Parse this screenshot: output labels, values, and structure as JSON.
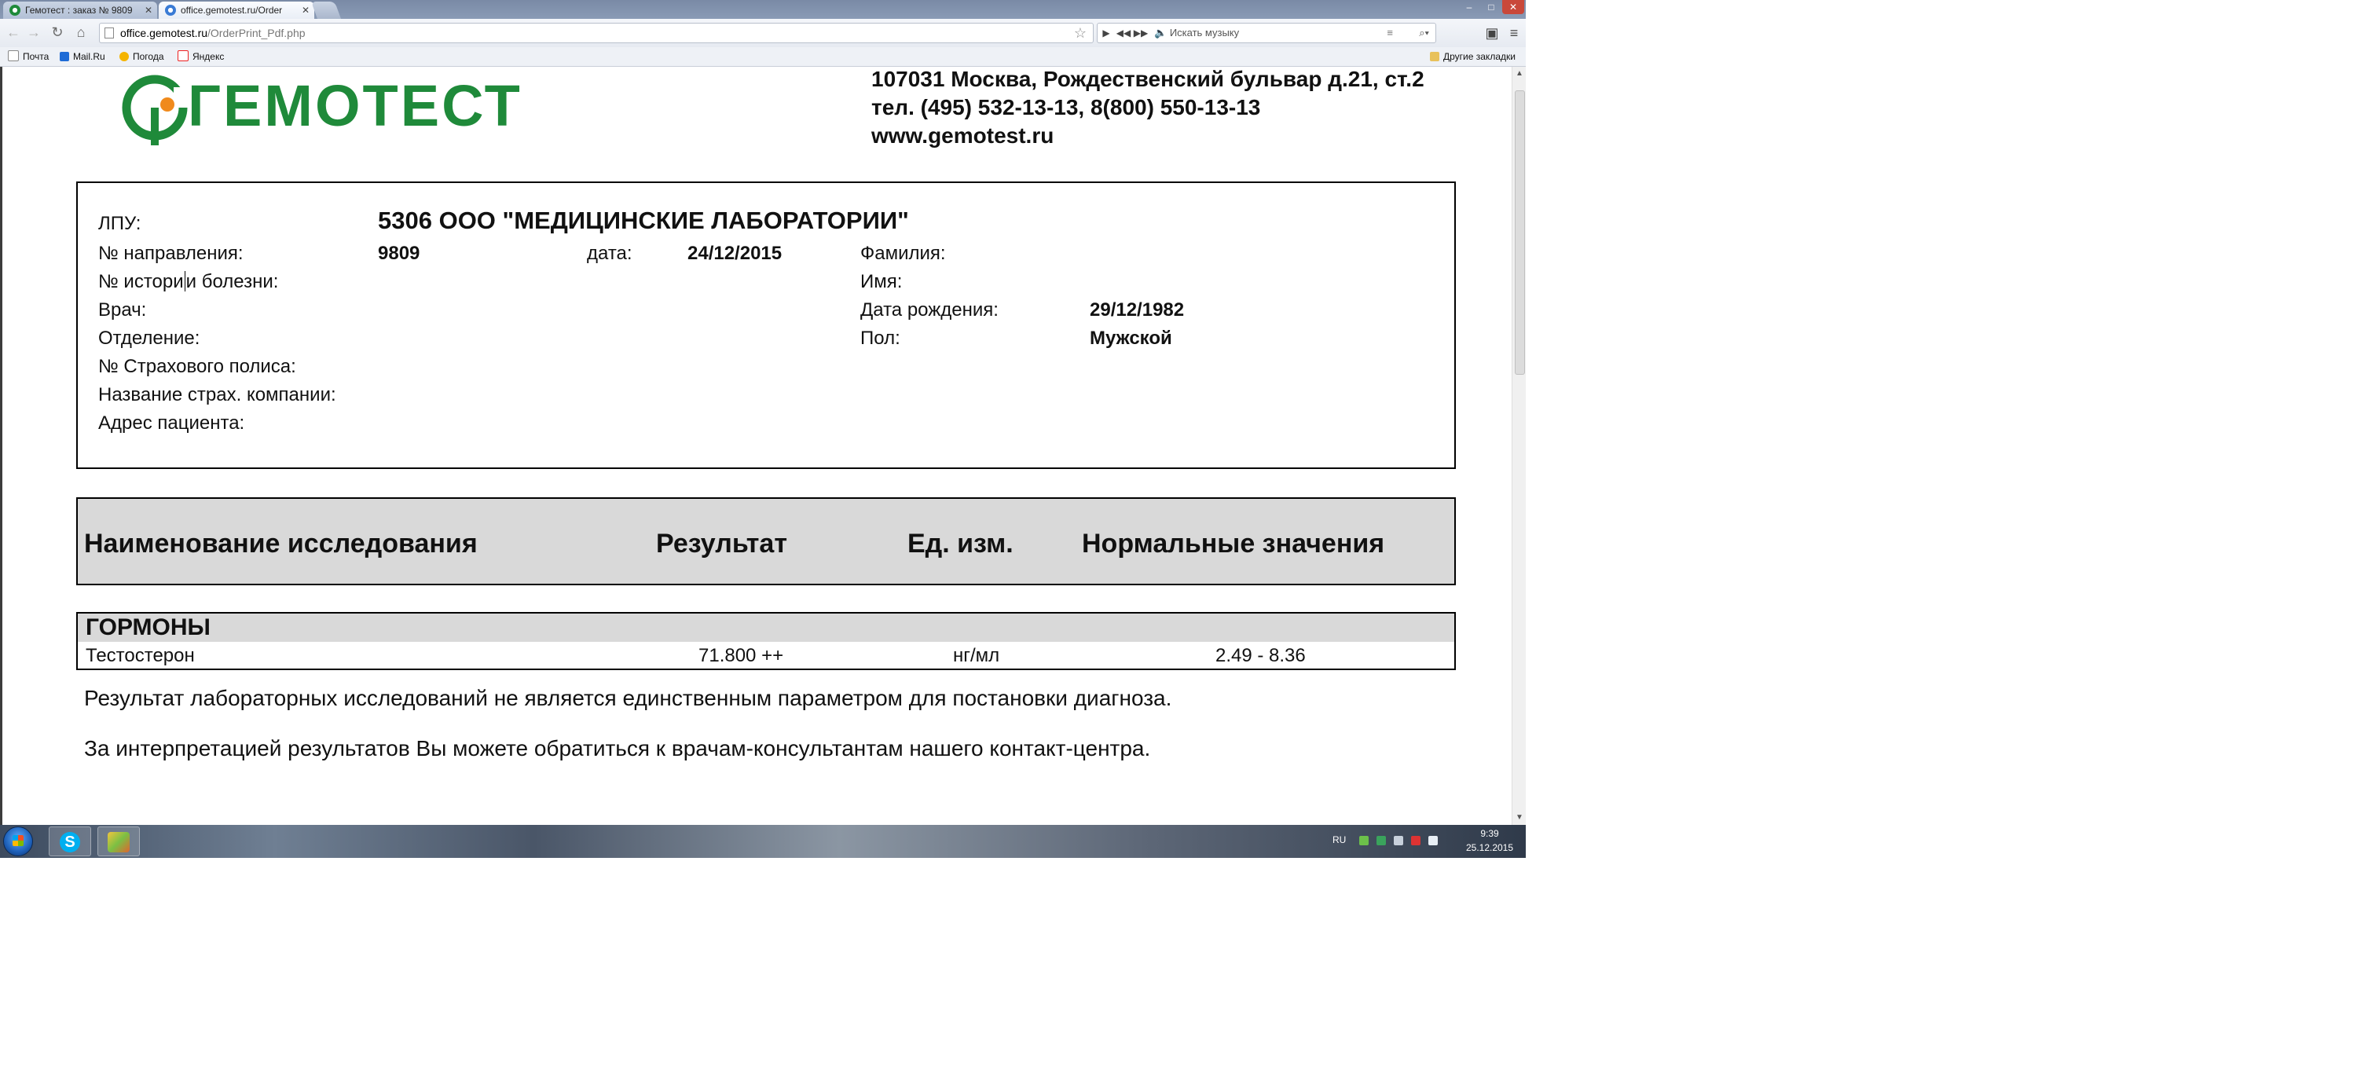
{
  "browser": {
    "tabs": [
      {
        "title": "Гемотест : заказ № 9809"
      },
      {
        "title": "office.gemotest.ru/Order"
      }
    ],
    "url": {
      "host": "office.gemotest.ru",
      "path": "/OrderPrint_Pdf.php"
    },
    "music_search_placeholder": "Искать музыку",
    "bookmarks": [
      "Почта",
      "Mail.Ru",
      "Погода",
      "Яндекс"
    ],
    "other_bookmarks": "Другие закладки"
  },
  "document": {
    "logo_text": "ГЕМОТЕСТ",
    "address": "107031 Москва, Рождественский бульвар д.21, ст.2",
    "phone": "тел. (495) 532-13-13, 8(800) 550-13-13",
    "website": "www.gemotest.ru",
    "patient": {
      "lpu_label": "ЛПУ:",
      "lpu_value": "5306 ООО \"МЕДИЦИНСКИЕ ЛАБОРАТОРИИ\"",
      "referral_label": "№ направления:",
      "referral_value": "9809",
      "date_label": "дата:",
      "date_value": "24/12/2015",
      "history_label_a": "№  истори",
      "history_label_b": "и болезни:",
      "doctor_label": "Врач:",
      "department_label": "Отделение:",
      "policy_label": "№ Страхового полиса:",
      "insurer_label": "Название страх. компании:",
      "address_label": "Адрес пациента:",
      "surname_label": "Фамилия:",
      "name_label": "Имя:",
      "birthdate_label": "Дата рождения:",
      "birthdate_value": "29/12/1982",
      "sex_label": "Пол:",
      "sex_value": "Мужской"
    },
    "results_header": {
      "name": "Наименование исследования",
      "result": "Результат",
      "unit": "Ед. изм.",
      "reference": "Нормальные значения"
    },
    "results": {
      "group": "ГОРМОНЫ",
      "rows": [
        {
          "name": "Тестостерон",
          "result": "71.800 ++",
          "unit": "нг/мл",
          "reference": "2.49 - 8.36"
        }
      ]
    },
    "notes": [
      "Результат лабораторных исследований не является единственным параметром для постановки диагноза.",
      "За интерпретацией результатов Вы можете обратиться к врачам-консультантам нашего контакт-центра."
    ]
  },
  "taskbar": {
    "language": "RU",
    "time": "9:39",
    "date": "25.12.2015"
  },
  "colors": {
    "logo_green": "#1f8a3a",
    "logo_orange": "#f08a1c",
    "header_gray": "#d9d9d9"
  }
}
